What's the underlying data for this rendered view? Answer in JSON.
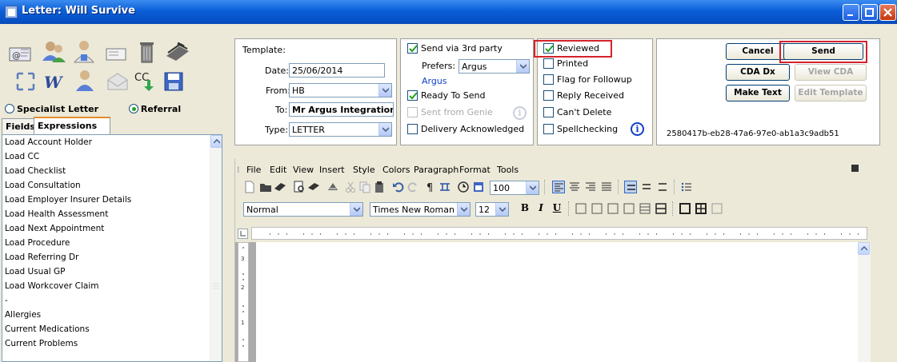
{
  "window": {
    "title": "Letter: Will Survive",
    "controls": [
      "minimize",
      "maximize",
      "close"
    ]
  },
  "left_panel": {
    "icon_buttons": [
      "email-icon",
      "users-icon",
      "doctor-icon",
      "message-icon",
      "trash-icon",
      "fax-icon",
      "expand-icon",
      "word-icon",
      "person-icon",
      "envelope-icon",
      "cc-icon",
      "save-icon"
    ],
    "cc_label": "CC",
    "radio": {
      "specialist": "Specialist Letter",
      "referral": "Referral",
      "selected": "referral"
    },
    "tabs": {
      "fields": "Fields",
      "expressions": "Expressions",
      "active": "Expressions"
    },
    "list_items": [
      "Load Account Holder",
      "Load CC",
      "Load Checklist",
      "Load Consultation",
      "Load Employer Insurer Details",
      "Load Health Assessment",
      "Load Next Appointment",
      "Load Procedure",
      "Load Referring Dr",
      "Load Usual GP",
      "Load Workcover Claim",
      "-",
      "Allergies",
      "Current Medications",
      "Current Problems"
    ]
  },
  "form": {
    "template_label": "Template:",
    "date_label": "Date:",
    "date_value": "25/06/2014",
    "from_label": "From:",
    "from_value": "HB",
    "to_label": "To:",
    "to_value": "Mr Argus Integration",
    "type_label": "Type:",
    "type_value": "LETTER"
  },
  "delivery": {
    "send_3rd_party": "Send via 3rd party",
    "send_3rd_party_checked": true,
    "prefers_label": "Prefers:",
    "prefers_value": "Argus",
    "argus_link": "Argus",
    "ready_to_send": "Ready To Send",
    "ready_to_send_checked": true,
    "sent_from_genie": "Sent from Genie",
    "delivery_ack": "Delivery Acknowledged"
  },
  "status": {
    "reviewed": "Reviewed",
    "reviewed_checked": true,
    "printed": "Printed",
    "flag_followup": "Flag for Followup",
    "reply_received": "Reply Received",
    "cant_delete": "Can't Delete",
    "spellchecking": "Spellchecking"
  },
  "actions": {
    "cancel": "Cancel",
    "send": "Send",
    "cda_dx": "CDA Dx",
    "view_cda": "View CDA",
    "make_text": "Make Text",
    "edit_template": "Edit Template",
    "guid": "2580417b-eb28-47a6-97e0-ab1a3c9adb51"
  },
  "editor": {
    "menu": [
      "File",
      "Edit",
      "View",
      "Insert",
      "Style",
      "Colors",
      "Paragraph",
      "Format",
      "Tools"
    ],
    "zoom": "100",
    "style": "Normal",
    "font": "Times New Roman",
    "size": "12",
    "bold": "B",
    "italic": "I",
    "underline": "U"
  },
  "colors": {
    "highlight": "#d4222a",
    "title_bar": "#0a5fd8",
    "link": "#1240c8"
  }
}
